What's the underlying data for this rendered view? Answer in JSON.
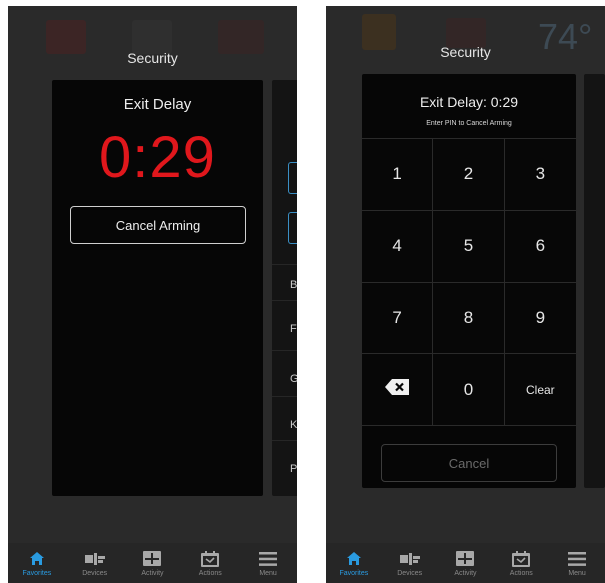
{
  "left_screen": {
    "header_title": "Security",
    "exit_delay_panel": {
      "title": "Exit Delay",
      "countdown": "0:29",
      "cancel_button_label": "Cancel Arming"
    },
    "side_panel_rows": [
      "B",
      "F",
      "G",
      "K",
      "P"
    ]
  },
  "right_screen": {
    "header_title": "Security",
    "background_temperature": "74°",
    "pin_panel": {
      "title": "Exit Delay: 0:29",
      "subtitle": "Enter PIN to Cancel Arming",
      "keys": [
        "1",
        "2",
        "3",
        "4",
        "5",
        "6",
        "7",
        "8",
        "9",
        "backspace",
        "0",
        "Clear"
      ],
      "cancel_button_label": "Cancel"
    }
  },
  "bottom_nav": {
    "items": [
      {
        "label": "Favorites",
        "icon": "home-icon",
        "active": true
      },
      {
        "label": "Devices",
        "icon": "devices-icon",
        "active": false
      },
      {
        "label": "Activity",
        "icon": "activity-icon",
        "active": false
      },
      {
        "label": "Actions",
        "icon": "actions-icon",
        "active": false
      },
      {
        "label": "Menu",
        "icon": "menu-icon",
        "active": false
      }
    ]
  },
  "colors": {
    "countdown_red": "#e0171c",
    "active_blue": "#2a9be0",
    "panel_black": "#060606"
  }
}
